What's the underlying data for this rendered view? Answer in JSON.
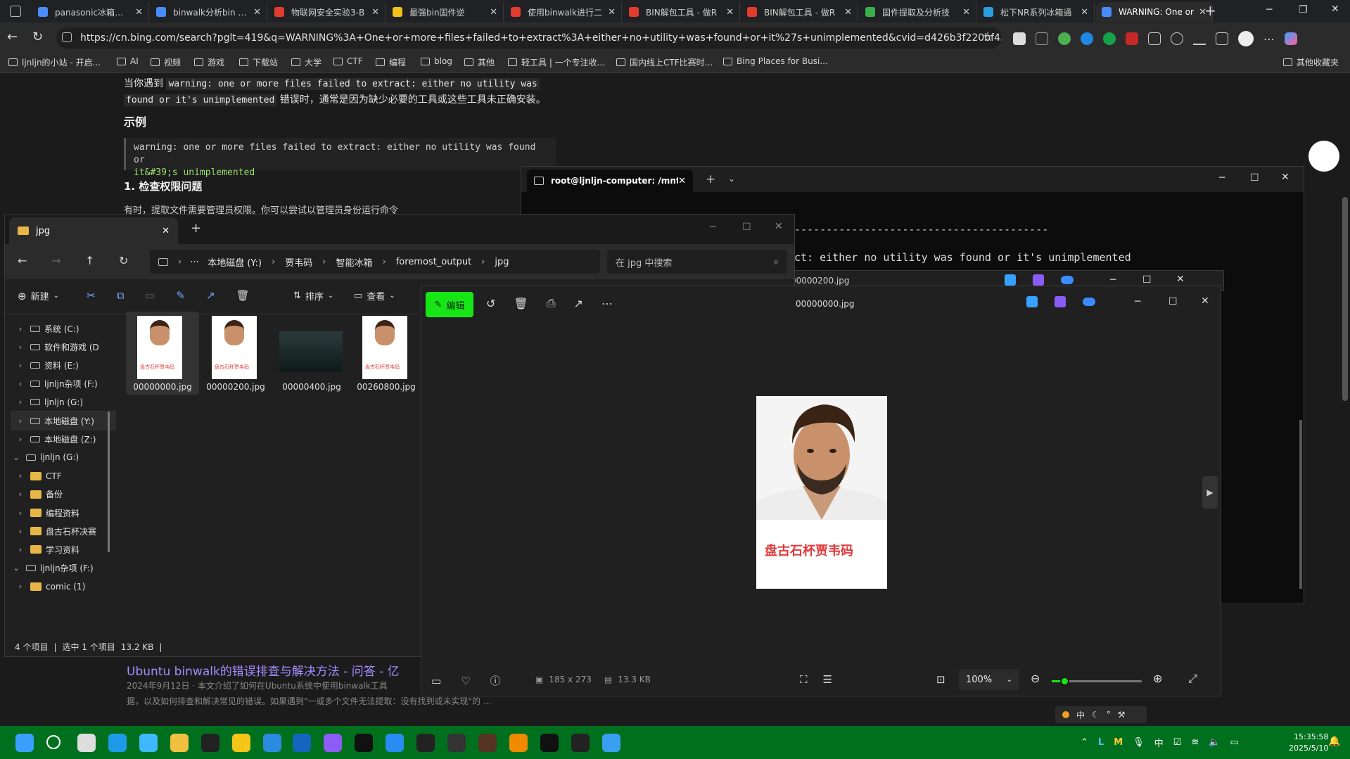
{
  "browser": {
    "tabs": [
      {
        "label": "panasonic冰箱固件",
        "color": "#4a8cff"
      },
      {
        "label": "binwalk分析bin - 搜",
        "color": "#4a8cff"
      },
      {
        "label": "物联网安全实验3-B",
        "color": "#e33b2e"
      },
      {
        "label": "最强bin固件逆",
        "color": "#f3c019"
      },
      {
        "label": "使用binwalk进行二",
        "color": "#e33b2e"
      },
      {
        "label": "BIN解包工具 - 做R",
        "color": "#e33b2e"
      },
      {
        "label": "BIN解包工具 - 做R",
        "color": "#e33b2e"
      },
      {
        "label": "固件提取及分析技",
        "color": "#3bb04a"
      },
      {
        "label": "松下NR系列冰箱通",
        "color": "#2aa0e0"
      },
      {
        "label": "WARNING: One or",
        "color": "#4a8cff"
      }
    ],
    "url": "https://cn.bing.com/search?pglt=419&q=WARNING%3A+One+or+more+files+failed+to+extract%3A+either+no+utility+was+found+or+it%27s+unimplemented&cvid=d426b3f220bf4305935df5a8e4eb9...",
    "favorites": [
      "ljnljn的小站 - 开启...",
      "AI",
      "视频",
      "游戏",
      "下载站",
      "大学",
      "CTF",
      "编程",
      "blog",
      "其他",
      "轻工具 | 一个专注收...",
      "国内线上CTF比赛时...",
      "Bing Places for Busi..."
    ],
    "other_favorites": "其他收藏夹"
  },
  "article": {
    "intro_pre": "当你遇到",
    "intro_code1": "warning: one or more files failed to extract: either no utility was",
    "intro_code2": "found or it's unimplemented",
    "intro_post": "错误时，通常是因为缺少必要的工具或这些工具未正确安装。",
    "example_heading": "示例",
    "example_line1": "warning: one or more files failed to extract: either no utility was found or",
    "example_line2": "it&#39;s unimplemented",
    "section1": "1. 检查权限问题",
    "section1_text": "有时，提取文件需要管理员权限。你可以尝试以管理员身份运行命令",
    "result_title": "Ubuntu binwalk的错误排查与解决方法 - 问答 - 亿",
    "result_date": "2024年9月12日",
    "result_snippet1": "本文介绍了如何在Ubuntu系统中使用binwalk工具",
    "result_snippet2": "据，以及如何排查和解决常见的错误。如果遇到\"一或多个文件无法提取：没有找到或未实现\"的 ..."
  },
  "terminal": {
    "tab_title": "root@ljnljn-computer: /mnt/y.",
    "line_dashes": "----------------------------------------",
    "line_text": "ct: either no utility was found or it's unimplemented"
  },
  "explorer": {
    "tab_title": "jpg",
    "breadcrumb": [
      "本地磁盘 (Y:)",
      "贾韦码",
      "智能冰箱",
      "foremost_output",
      "jpg"
    ],
    "search_placeholder": "在 jpg 中搜索",
    "toolbar": {
      "new": "新建",
      "sort": "排序",
      "view": "查看"
    },
    "tree": [
      {
        "label": "系统 (C:)",
        "type": "drive",
        "indent": 1
      },
      {
        "label": "软件和游戏 (D",
        "type": "drive",
        "indent": 1
      },
      {
        "label": "资料 (E:)",
        "type": "drive",
        "indent": 1
      },
      {
        "label": "ljnljn杂项 (F:)",
        "type": "drive",
        "indent": 1
      },
      {
        "label": "ljnljn (G:)",
        "type": "drive",
        "indent": 1
      },
      {
        "label": "本地磁盘 (Y:)",
        "type": "drive",
        "indent": 1
      },
      {
        "label": "本地磁盘 (Z:)",
        "type": "drive",
        "indent": 1
      },
      {
        "label": "ljnljn (G:)",
        "type": "drive",
        "indent": 0
      },
      {
        "label": "CTF",
        "type": "folder",
        "indent": 1
      },
      {
        "label": "备份",
        "type": "folder",
        "indent": 1
      },
      {
        "label": "编程资料",
        "type": "folder",
        "indent": 1
      },
      {
        "label": "盘古石杯决赛",
        "type": "folder",
        "indent": 1
      },
      {
        "label": "学习资料",
        "type": "folder",
        "indent": 1
      },
      {
        "label": "ljnljn杂项 (F:)",
        "type": "drive",
        "indent": 0
      },
      {
        "label": "comic (1)",
        "type": "folder",
        "indent": 1
      }
    ],
    "files": [
      "00000000.jpg",
      "00000200.jpg",
      "00000400.jpg",
      "00260800.jpg"
    ],
    "thumb_caption": "盘古石杯贾韦码",
    "status": {
      "count": "4 个项目",
      "selected": "选中 1 个项目",
      "size": "13.2 KB"
    }
  },
  "viewer": {
    "edit_label": "编辑",
    "title": "00000000.jpg",
    "back_title": "00000200.jpg",
    "image_caption": "盘古石杯贾韦码",
    "dimensions": "185 x 273",
    "filesize": "13.3 KB",
    "zoom": "100%"
  },
  "tray": {
    "ime": "中",
    "time": "15:35:58",
    "date": "2025/5/10",
    "ime_bar": "中"
  }
}
